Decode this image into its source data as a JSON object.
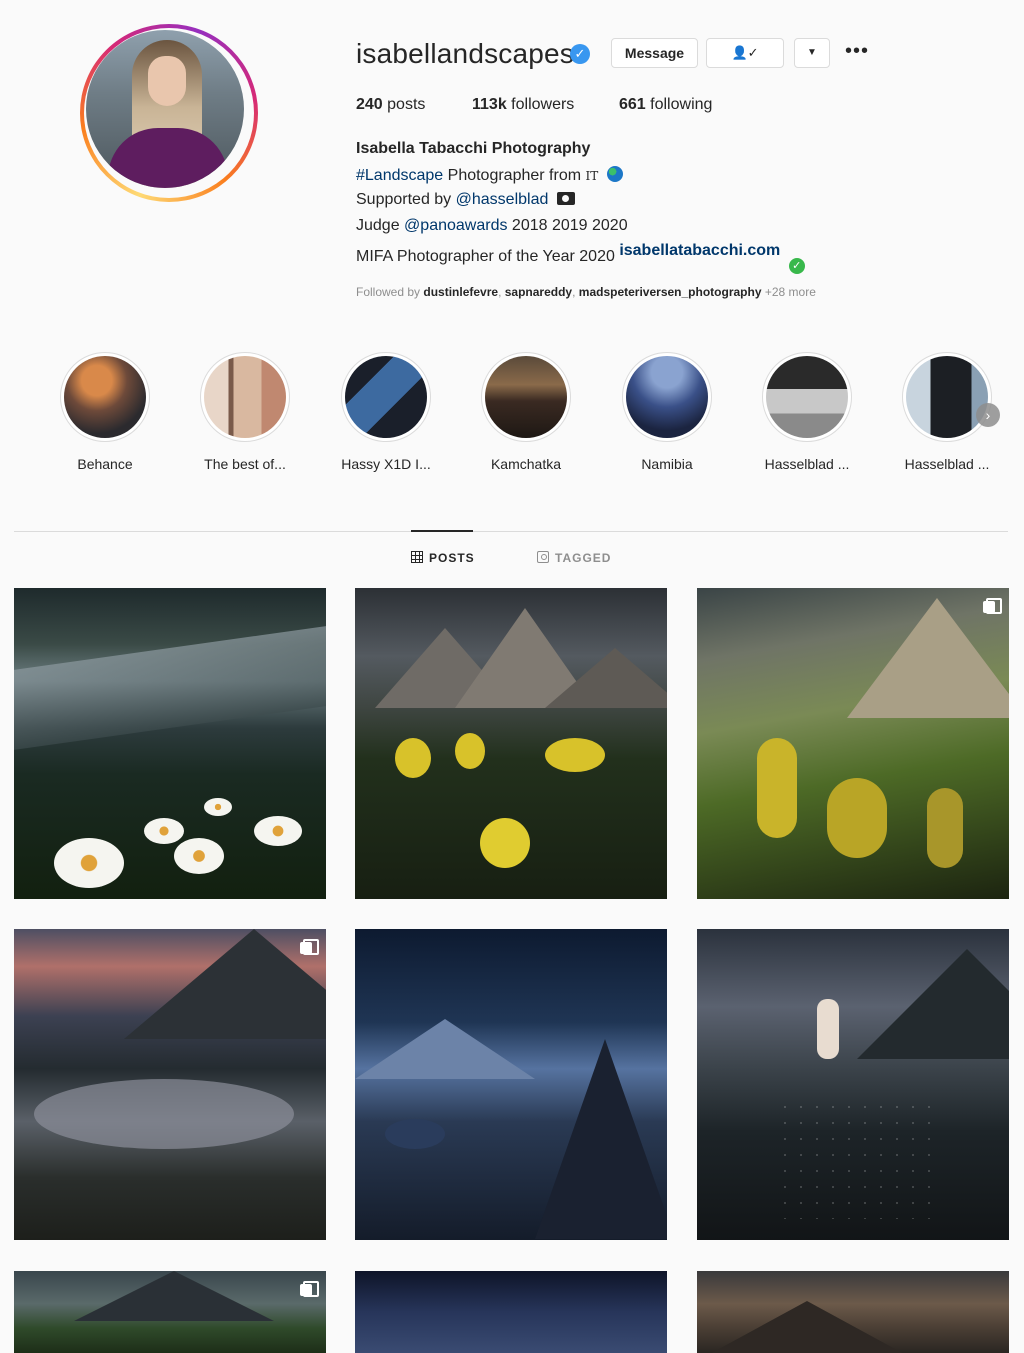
{
  "profile": {
    "username": "isabellandscapes",
    "verified_icon": "verified-badge-icon",
    "buttons": {
      "message": "Message",
      "follow_icon": "person-check-icon",
      "dropdown_icon": "caret-down-icon",
      "more_icon": "more-options-icon"
    },
    "stats": {
      "posts_count": "240",
      "posts_label": "posts",
      "followers_count": "113k",
      "followers_label": "followers",
      "following_count": "661",
      "following_label": "following"
    },
    "bio": {
      "name": "Isabella Tabacchi Photography",
      "hashtag": "#Landscape",
      "line1_text": "Photographer from",
      "country_code": "IT",
      "line2_prefix": "Supported by",
      "line2_mention": "@hasselblad",
      "line3_prefix": "Judge",
      "line3_mention": "@panoawards",
      "line3_years": "2018 2019 2020",
      "line4_text": "MIFA Photographer of the Year 2020",
      "website": "isabellatabacchi.com"
    },
    "followed_by": {
      "prefix": "Followed by",
      "user1": "dustinlefevre",
      "user2": "sapnareddy",
      "user3": "madspeteriversen_photography",
      "more": "+28 more"
    }
  },
  "highlights": [
    {
      "label": "Behance"
    },
    {
      "label": "The best of..."
    },
    {
      "label": "Hassy X1D I..."
    },
    {
      "label": "Kamchatka"
    },
    {
      "label": "Namibia"
    },
    {
      "label": "Hasselblad ..."
    },
    {
      "label": "Hasselblad ..."
    }
  ],
  "tabs": {
    "posts": "POSTS",
    "tagged": "TAGGED"
  },
  "colors": {
    "accent_link": "#00376b",
    "verified_blue": "#3897f0",
    "check_green": "#38b84b",
    "background": "#fafafa"
  }
}
